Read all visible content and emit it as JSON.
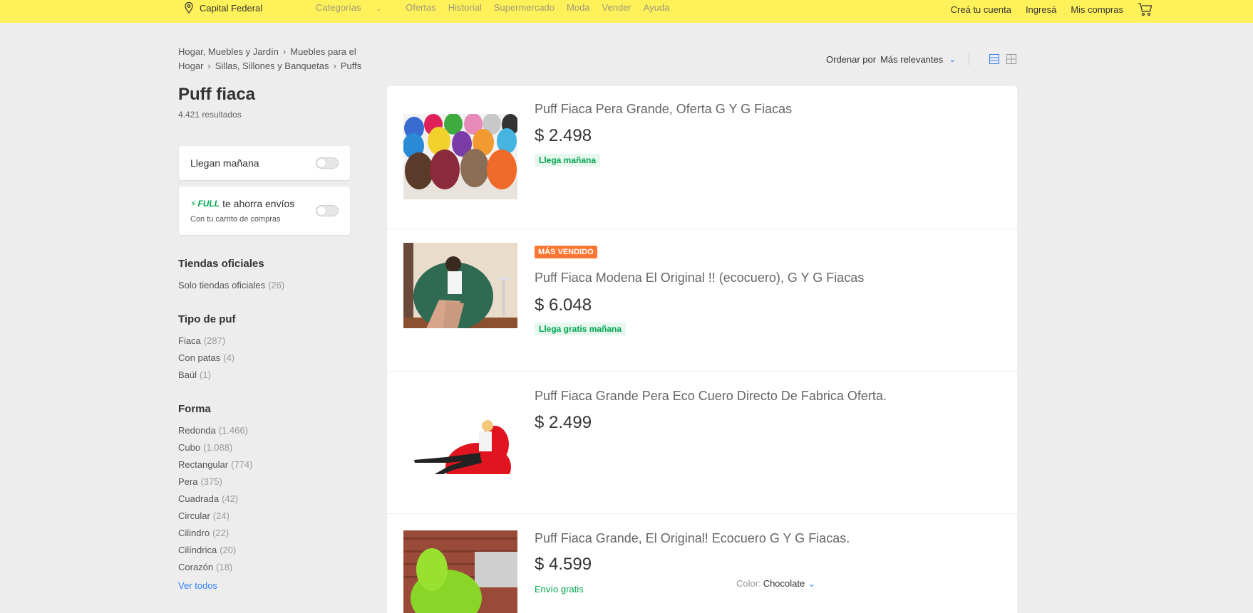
{
  "header": {
    "location": "Capital Federal",
    "nav": [
      "Categorías",
      "Ofertas",
      "Historial",
      "Supermercado",
      "Moda",
      "Vender",
      "Ayuda"
    ],
    "create_account": "Creá tu cuenta",
    "login": "Ingresá",
    "my_purchases": "Mis compras"
  },
  "breadcrumb": {
    "items": [
      "Hogar, Muebles y Jardín",
      "Muebles para el Hogar",
      "Sillas, Sillones y Banquetas",
      "Puffs"
    ]
  },
  "sort": {
    "label": "Ordenar por",
    "value": "Más relevantes"
  },
  "search": {
    "title": "Puff fiaca",
    "results": "4.421 resultados"
  },
  "filters": {
    "arrives_tomorrow": "Llegan mañana",
    "full_label": "FULL",
    "full_text": "te ahorra envíos",
    "full_sub": "Con tu carrito de compras"
  },
  "facets": {
    "official": {
      "title": "Tiendas oficiales",
      "items": [
        {
          "label": "Solo tiendas oficiales",
          "count": "(26)"
        }
      ]
    },
    "tipo": {
      "title": "Tipo de puf",
      "items": [
        {
          "label": "Fiaca",
          "count": "(287)"
        },
        {
          "label": "Con patas",
          "count": "(4)"
        },
        {
          "label": "Baúl",
          "count": "(1)"
        }
      ]
    },
    "forma": {
      "title": "Forma",
      "items": [
        {
          "label": "Redonda",
          "count": "(1.466)"
        },
        {
          "label": "Cubo",
          "count": "(1.088)"
        },
        {
          "label": "Rectangular",
          "count": "(774)"
        },
        {
          "label": "Pera",
          "count": "(375)"
        },
        {
          "label": "Cuadrada",
          "count": "(42)"
        },
        {
          "label": "Circular",
          "count": "(24)"
        },
        {
          "label": "Cilindro",
          "count": "(22)"
        },
        {
          "label": "Cilíndrica",
          "count": "(20)"
        },
        {
          "label": "Corazón",
          "count": "(18)"
        }
      ],
      "see_all": "Ver todos"
    }
  },
  "products": [
    {
      "title": "Puff Fiaca Pera Grande, Oferta G Y G Fiacas",
      "price": "$ 2.498",
      "shipping": "Llega mañana"
    },
    {
      "badge": "MÁS VENDIDO",
      "title": "Puff Fiaca Modena El Original !! (ecocuero), G Y G Fiacas",
      "price": "$ 6.048",
      "shipping": "Llega gratis mañana"
    },
    {
      "title": "Puff Fiaca Grande Pera Eco Cuero Directo De Fabrica Oferta.",
      "price": "$ 2.499"
    },
    {
      "title": "Puff Fiaca Grande, El Original! Ecocuero G Y G Fiacas.",
      "price": "$ 4.599",
      "shipping": "Envío gratis",
      "color_label": "Color:",
      "color_value": "Chocolate"
    }
  ],
  "colors": {
    "header_bg": "#fff159",
    "accent_blue": "#3483fa",
    "green": "#00a650",
    "orange": "#ff7733"
  }
}
